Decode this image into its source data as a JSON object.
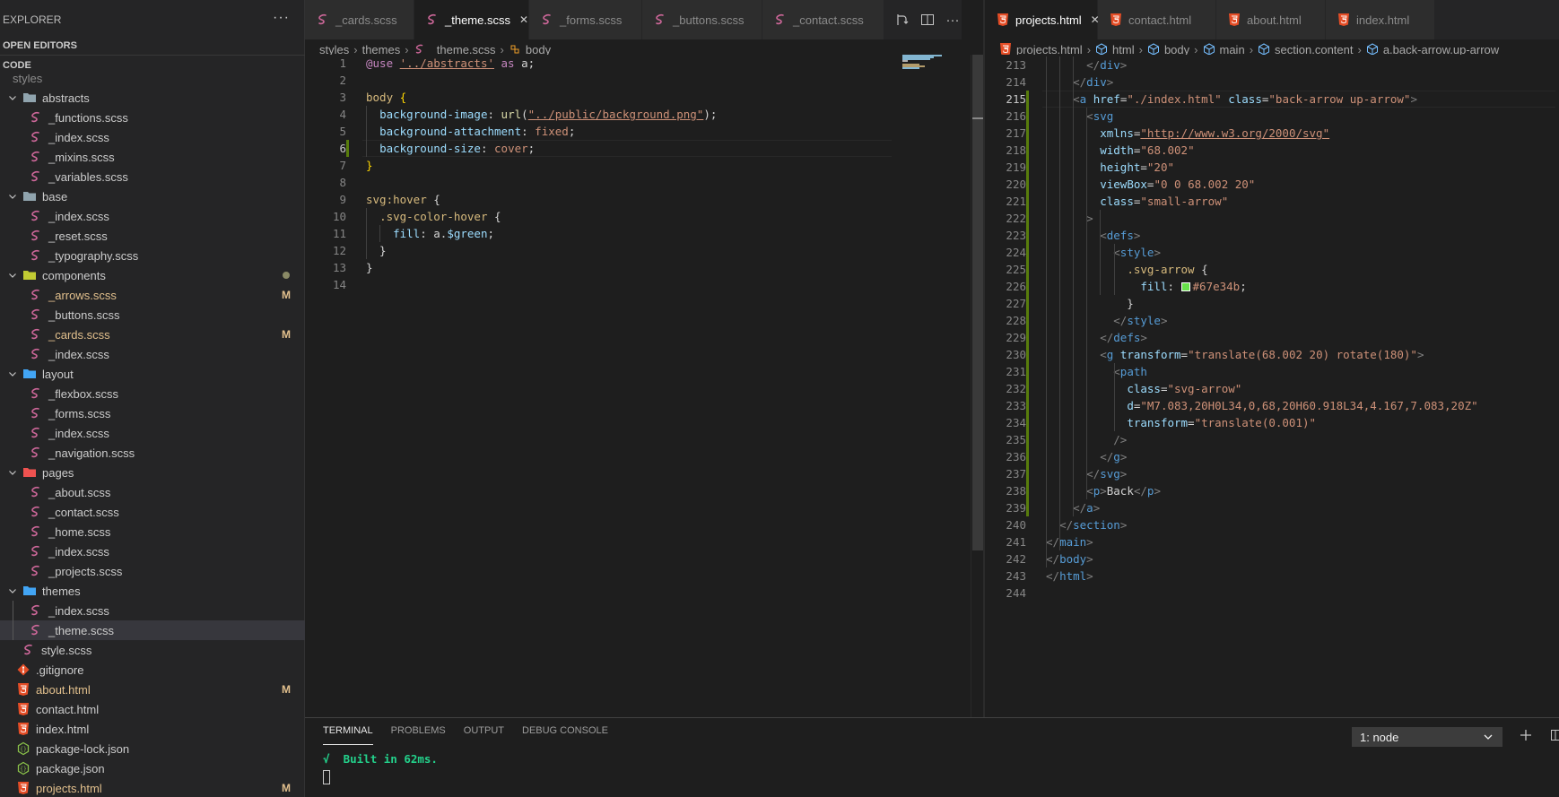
{
  "colors": {
    "accent_modified": "#e2c08d",
    "sass_icon": "#cd6799",
    "html_icon": "#e44d26",
    "json_icon": "#8bc34a",
    "terminal_success": "#23d18b",
    "swatch_green": "#67e34b"
  },
  "sidebar": {
    "title": "EXPLORER",
    "more_icon": "ellipsis-icon",
    "open_editors_label": "OPEN EDITORS",
    "root_label": "CODE",
    "tree": [
      {
        "label": "styles",
        "kind": "folder-partial",
        "depth": 0
      },
      {
        "label": "abstracts",
        "kind": "folder",
        "depth": 1,
        "icon": "folder-icon"
      },
      {
        "label": "_functions.scss",
        "kind": "scss",
        "depth": 2
      },
      {
        "label": "_index.scss",
        "kind": "scss",
        "depth": 2
      },
      {
        "label": "_mixins.scss",
        "kind": "scss",
        "depth": 2
      },
      {
        "label": "_variables.scss",
        "kind": "scss",
        "depth": 2
      },
      {
        "label": "base",
        "kind": "folder",
        "depth": 1,
        "icon": "folder-icon"
      },
      {
        "label": "_index.scss",
        "kind": "scss",
        "depth": 2
      },
      {
        "label": "_reset.scss",
        "kind": "scss",
        "depth": 2
      },
      {
        "label": "_typography.scss",
        "kind": "scss",
        "depth": 2
      },
      {
        "label": "components",
        "kind": "folder",
        "depth": 1,
        "icon": "folder-components-icon",
        "modified_dot": true
      },
      {
        "label": "_arrows.scss",
        "kind": "scss",
        "depth": 2,
        "badge": "M"
      },
      {
        "label": "_buttons.scss",
        "kind": "scss",
        "depth": 2
      },
      {
        "label": "_cards.scss",
        "kind": "scss",
        "depth": 2,
        "badge": "M"
      },
      {
        "label": "_index.scss",
        "kind": "scss",
        "depth": 2
      },
      {
        "label": "layout",
        "kind": "folder",
        "depth": 1,
        "icon": "folder-layout-icon"
      },
      {
        "label": "_flexbox.scss",
        "kind": "scss",
        "depth": 2
      },
      {
        "label": "_forms.scss",
        "kind": "scss",
        "depth": 2
      },
      {
        "label": "_index.scss",
        "kind": "scss",
        "depth": 2
      },
      {
        "label": "_navigation.scss",
        "kind": "scss",
        "depth": 2
      },
      {
        "label": "pages",
        "kind": "folder",
        "depth": 1,
        "icon": "folder-pages-icon"
      },
      {
        "label": "_about.scss",
        "kind": "scss",
        "depth": 2
      },
      {
        "label": "_contact.scss",
        "kind": "scss",
        "depth": 2
      },
      {
        "label": "_home.scss",
        "kind": "scss",
        "depth": 2
      },
      {
        "label": "_index.scss",
        "kind": "scss",
        "depth": 2
      },
      {
        "label": "_projects.scss",
        "kind": "scss",
        "depth": 2
      },
      {
        "label": "themes",
        "kind": "folder",
        "depth": 1,
        "icon": "folder-themes-icon"
      },
      {
        "label": "_index.scss",
        "kind": "scss",
        "depth": 2
      },
      {
        "label": "_theme.scss",
        "kind": "scss",
        "depth": 2,
        "active": true
      },
      {
        "label": "style.scss",
        "kind": "scss",
        "depth": 1
      },
      {
        "label": ".gitignore",
        "kind": "git",
        "depth": 0
      },
      {
        "label": "about.html",
        "kind": "html",
        "depth": 0,
        "badge": "M"
      },
      {
        "label": "contact.html",
        "kind": "html",
        "depth": 0
      },
      {
        "label": "index.html",
        "kind": "html",
        "depth": 0
      },
      {
        "label": "package-lock.json",
        "kind": "json",
        "depth": 0
      },
      {
        "label": "package.json",
        "kind": "json",
        "depth": 0
      },
      {
        "label": "projects.html",
        "kind": "html",
        "depth": 0,
        "badge": "M"
      }
    ]
  },
  "left_editor": {
    "tabs": [
      {
        "label": "_cards.scss",
        "icon": "sass-icon"
      },
      {
        "label": "_theme.scss",
        "icon": "sass-icon",
        "active": true
      },
      {
        "label": "_forms.scss",
        "icon": "sass-icon"
      },
      {
        "label": "_buttons.scss",
        "icon": "sass-icon"
      },
      {
        "label": "_contact.scss",
        "icon": "sass-icon"
      }
    ],
    "actions": [
      "open-changes-icon",
      "split-editor-icon",
      "ellipsis-icon"
    ],
    "breadcrumb": [
      "styles",
      "themes",
      "_theme.scss",
      "body"
    ],
    "current_line": 6,
    "lines": [
      {
        "n": "1",
        "tokens": [
          [
            "t-kw",
            "@use "
          ],
          [
            "t-url",
            "'../abstracts'"
          ],
          [
            "t-kw",
            " as "
          ],
          [
            "t-txt",
            "a;"
          ]
        ]
      },
      {
        "n": "2",
        "tokens": []
      },
      {
        "n": "3",
        "tokens": [
          [
            "t-sel",
            "body "
          ],
          [
            "t-brk",
            "{"
          ]
        ]
      },
      {
        "n": "4",
        "tokens": [
          [
            "t-txt",
            "  "
          ],
          [
            "t-prop",
            "background-image"
          ],
          [
            "t-txt",
            ": "
          ],
          [
            "t-fn",
            "url"
          ],
          [
            "t-txt",
            "("
          ],
          [
            "t-url",
            "\"../public/background.png\""
          ],
          [
            "t-txt",
            ");"
          ]
        ]
      },
      {
        "n": "5",
        "tokens": [
          [
            "t-txt",
            "  "
          ],
          [
            "t-prop",
            "background-attachment"
          ],
          [
            "t-txt",
            ": "
          ],
          [
            "t-val",
            "fixed"
          ],
          [
            "t-txt",
            ";"
          ]
        ]
      },
      {
        "n": "6",
        "tokens": [
          [
            "t-txt",
            "  "
          ],
          [
            "t-prop",
            "background-size"
          ],
          [
            "t-txt",
            ": "
          ],
          [
            "t-val",
            "cover"
          ],
          [
            "t-txt",
            ";"
          ]
        ]
      },
      {
        "n": "7",
        "tokens": [
          [
            "t-brk",
            "}"
          ]
        ]
      },
      {
        "n": "8",
        "tokens": []
      },
      {
        "n": "9",
        "tokens": [
          [
            "t-sel",
            "svg:hover "
          ],
          [
            "t-txt",
            "{"
          ]
        ]
      },
      {
        "n": "10",
        "tokens": [
          [
            "t-txt",
            "  "
          ],
          [
            "t-cls",
            ".svg-color-hover "
          ],
          [
            "t-txt",
            "{"
          ]
        ]
      },
      {
        "n": "11",
        "tokens": [
          [
            "t-txt",
            "    "
          ],
          [
            "t-prop",
            "fill"
          ],
          [
            "t-txt",
            ": a."
          ],
          [
            "t-var",
            "$green"
          ],
          [
            "t-txt",
            ";"
          ]
        ]
      },
      {
        "n": "12",
        "tokens": [
          [
            "t-txt",
            "  }"
          ]
        ]
      },
      {
        "n": "13",
        "tokens": [
          [
            "t-txt",
            "}"
          ]
        ]
      },
      {
        "n": "14",
        "tokens": []
      }
    ]
  },
  "right_editor": {
    "tabs": [
      {
        "label": "projects.html",
        "icon": "html5-icon",
        "active": true
      },
      {
        "label": "contact.html",
        "icon": "html5-icon"
      },
      {
        "label": "about.html",
        "icon": "html5-icon"
      },
      {
        "label": "index.html",
        "icon": "html5-icon"
      }
    ],
    "breadcrumb": [
      "projects.html",
      "html",
      "body",
      "main",
      "section.content",
      "a.back-arrow.up-arrow"
    ],
    "current_line": 215,
    "lines": [
      {
        "n": "213",
        "tokens": [
          [
            "t-txt",
            "      "
          ],
          [
            "t-br",
            "</"
          ],
          [
            "t-tag",
            "div"
          ],
          [
            "t-br",
            ">"
          ]
        ]
      },
      {
        "n": "214",
        "tokens": [
          [
            "t-txt",
            "    "
          ],
          [
            "t-br",
            "</"
          ],
          [
            "t-tag",
            "div"
          ],
          [
            "t-br",
            ">"
          ]
        ]
      },
      {
        "n": "215",
        "tokens": [
          [
            "t-txt",
            "    "
          ],
          [
            "t-br",
            "<"
          ],
          [
            "t-tag",
            "a "
          ],
          [
            "t-attr",
            "href"
          ],
          [
            "t-txt",
            "="
          ],
          [
            "t-str",
            "\"./index.html\" "
          ],
          [
            "t-attr",
            "class"
          ],
          [
            "t-txt",
            "="
          ],
          [
            "t-str",
            "\"back-arrow up-arrow\""
          ],
          [
            "t-br",
            ">"
          ]
        ]
      },
      {
        "n": "216",
        "tokens": [
          [
            "t-txt",
            "      "
          ],
          [
            "t-br",
            "<"
          ],
          [
            "t-tag",
            "svg"
          ]
        ]
      },
      {
        "n": "217",
        "tokens": [
          [
            "t-txt",
            "        "
          ],
          [
            "t-attr",
            "xmlns"
          ],
          [
            "t-txt",
            "="
          ],
          [
            "t-url",
            "\"http://www.w3.org/2000/svg\""
          ]
        ]
      },
      {
        "n": "218",
        "tokens": [
          [
            "t-txt",
            "        "
          ],
          [
            "t-attr",
            "width"
          ],
          [
            "t-txt",
            "="
          ],
          [
            "t-str",
            "\"68.002\""
          ]
        ]
      },
      {
        "n": "219",
        "tokens": [
          [
            "t-txt",
            "        "
          ],
          [
            "t-attr",
            "height"
          ],
          [
            "t-txt",
            "="
          ],
          [
            "t-str",
            "\"20\""
          ]
        ]
      },
      {
        "n": "220",
        "tokens": [
          [
            "t-txt",
            "        "
          ],
          [
            "t-attr",
            "viewBox"
          ],
          [
            "t-txt",
            "="
          ],
          [
            "t-str",
            "\"0 0 68.002 20\""
          ]
        ]
      },
      {
        "n": "221",
        "tokens": [
          [
            "t-txt",
            "        "
          ],
          [
            "t-attr",
            "class"
          ],
          [
            "t-txt",
            "="
          ],
          [
            "t-str",
            "\"small-arrow\""
          ]
        ]
      },
      {
        "n": "222",
        "tokens": [
          [
            "t-txt",
            "      "
          ],
          [
            "t-br",
            ">"
          ]
        ]
      },
      {
        "n": "223",
        "tokens": [
          [
            "t-txt",
            "        "
          ],
          [
            "t-br",
            "<"
          ],
          [
            "t-tag",
            "defs"
          ],
          [
            "t-br",
            ">"
          ]
        ]
      },
      {
        "n": "224",
        "tokens": [
          [
            "t-txt",
            "          "
          ],
          [
            "t-br",
            "<"
          ],
          [
            "t-tag",
            "style"
          ],
          [
            "t-br",
            ">"
          ]
        ]
      },
      {
        "n": "225",
        "tokens": [
          [
            "t-txt",
            "            "
          ],
          [
            "t-cls",
            ".svg-arrow "
          ],
          [
            "t-txt",
            "{"
          ]
        ]
      },
      {
        "n": "226",
        "tokens": [
          [
            "t-txt",
            "              "
          ],
          [
            "t-prop",
            "fill"
          ],
          [
            "t-txt",
            ": "
          ],
          [
            "swatch",
            ""
          ],
          [
            "t-val",
            "#67e34b"
          ],
          [
            "t-txt",
            ";"
          ]
        ]
      },
      {
        "n": "227",
        "tokens": [
          [
            "t-txt",
            "            }"
          ]
        ]
      },
      {
        "n": "228",
        "tokens": [
          [
            "t-txt",
            "          "
          ],
          [
            "t-br",
            "</"
          ],
          [
            "t-tag",
            "style"
          ],
          [
            "t-br",
            ">"
          ]
        ]
      },
      {
        "n": "229",
        "tokens": [
          [
            "t-txt",
            "        "
          ],
          [
            "t-br",
            "</"
          ],
          [
            "t-tag",
            "defs"
          ],
          [
            "t-br",
            ">"
          ]
        ]
      },
      {
        "n": "230",
        "tokens": [
          [
            "t-txt",
            "        "
          ],
          [
            "t-br",
            "<"
          ],
          [
            "t-tag",
            "g "
          ],
          [
            "t-attr",
            "transform"
          ],
          [
            "t-txt",
            "="
          ],
          [
            "t-str",
            "\"translate(68.002 20) rotate(180)\""
          ],
          [
            "t-br",
            ">"
          ]
        ]
      },
      {
        "n": "231",
        "tokens": [
          [
            "t-txt",
            "          "
          ],
          [
            "t-br",
            "<"
          ],
          [
            "t-tag",
            "path"
          ]
        ]
      },
      {
        "n": "232",
        "tokens": [
          [
            "t-txt",
            "            "
          ],
          [
            "t-attr",
            "class"
          ],
          [
            "t-txt",
            "="
          ],
          [
            "t-str",
            "\"svg-arrow\""
          ]
        ]
      },
      {
        "n": "233",
        "tokens": [
          [
            "t-txt",
            "            "
          ],
          [
            "t-attr",
            "d"
          ],
          [
            "t-txt",
            "="
          ],
          [
            "t-str",
            "\"M7.083,20H0L34,0,68,20H60.918L34,4.167,7.083,20Z\""
          ]
        ]
      },
      {
        "n": "234",
        "tokens": [
          [
            "t-txt",
            "            "
          ],
          [
            "t-attr",
            "transform"
          ],
          [
            "t-txt",
            "="
          ],
          [
            "t-str",
            "\"translate(0.001)\""
          ]
        ]
      },
      {
        "n": "235",
        "tokens": [
          [
            "t-txt",
            "          "
          ],
          [
            "t-br",
            "/>"
          ]
        ]
      },
      {
        "n": "236",
        "tokens": [
          [
            "t-txt",
            "        "
          ],
          [
            "t-br",
            "</"
          ],
          [
            "t-tag",
            "g"
          ],
          [
            "t-br",
            ">"
          ]
        ]
      },
      {
        "n": "237",
        "tokens": [
          [
            "t-txt",
            "      "
          ],
          [
            "t-br",
            "</"
          ],
          [
            "t-tag",
            "svg"
          ],
          [
            "t-br",
            ">"
          ]
        ]
      },
      {
        "n": "238",
        "tokens": [
          [
            "t-txt",
            "      "
          ],
          [
            "t-br",
            "<"
          ],
          [
            "t-tag",
            "p"
          ],
          [
            "t-br",
            ">"
          ],
          [
            "t-txt",
            "Back"
          ],
          [
            "t-br",
            "</"
          ],
          [
            "t-tag",
            "p"
          ],
          [
            "t-br",
            ">"
          ]
        ]
      },
      {
        "n": "239",
        "tokens": [
          [
            "t-txt",
            "    "
          ],
          [
            "t-br",
            "</"
          ],
          [
            "t-tag",
            "a"
          ],
          [
            "t-br",
            ">"
          ]
        ]
      },
      {
        "n": "240",
        "tokens": [
          [
            "t-txt",
            "  "
          ],
          [
            "t-br",
            "</"
          ],
          [
            "t-tag",
            "section"
          ],
          [
            "t-br",
            ">"
          ]
        ]
      },
      {
        "n": "241",
        "tokens": [
          [
            "t-txt",
            ""
          ],
          [
            "t-br",
            "</"
          ],
          [
            "t-tag",
            "main"
          ],
          [
            "t-br",
            ">"
          ]
        ]
      },
      {
        "n": "242",
        "tokens": [
          [
            "t-br",
            "</"
          ],
          [
            "t-tag",
            "body"
          ],
          [
            "t-br",
            ">"
          ]
        ]
      },
      {
        "n": "243",
        "tokens": [
          [
            "t-br",
            "</"
          ],
          [
            "t-tag",
            "html"
          ],
          [
            "t-br",
            ">"
          ]
        ]
      },
      {
        "n": "244",
        "tokens": []
      }
    ]
  },
  "panel": {
    "tabs": [
      {
        "label": "TERMINAL",
        "active": true
      },
      {
        "label": "PROBLEMS"
      },
      {
        "label": "OUTPUT"
      },
      {
        "label": "DEBUG CONSOLE"
      }
    ],
    "terminal_select": "1: node",
    "output_check": "√",
    "output_text": "Built in 62ms.",
    "actions": [
      "plus-icon",
      "split-terminal-icon"
    ]
  }
}
